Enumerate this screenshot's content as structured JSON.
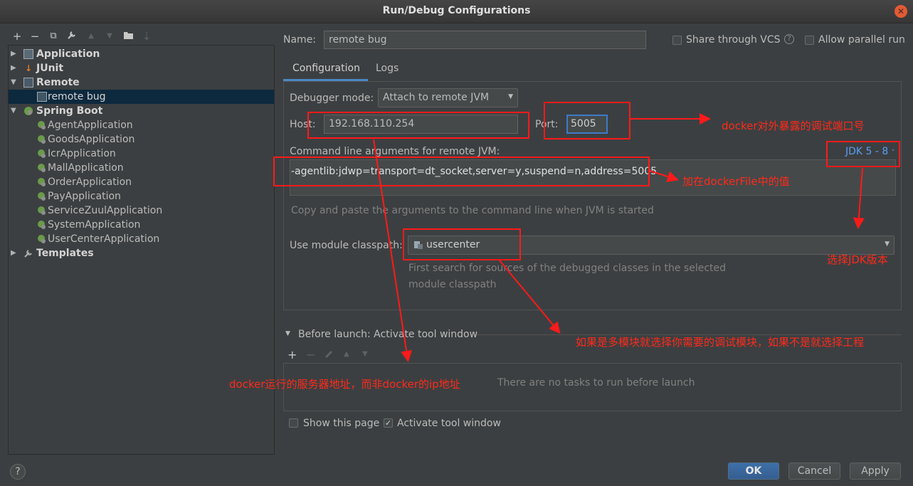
{
  "window": {
    "title": "Run/Debug Configurations"
  },
  "toolbar": {
    "add": "+",
    "remove": "−",
    "copy": "⧉",
    "edit": "🔧",
    "up": "▲",
    "down": "▼",
    "folder": "▪",
    "sort": "⇣"
  },
  "tree": {
    "groups": [
      {
        "label": "Application",
        "icon": "application-icon"
      },
      {
        "label": "JUnit",
        "icon": "junit-icon"
      },
      {
        "label": "Remote",
        "icon": "remote-icon"
      },
      {
        "label": "Spring Boot",
        "icon": "spring-boot-icon"
      },
      {
        "label": "Templates",
        "icon": "wrench-icon"
      }
    ],
    "remote_children": [
      "remote bug"
    ],
    "spring_children": [
      "AgentApplication",
      "GoodsApplication",
      "IcrApplication",
      "MallApplication",
      "OrderApplication",
      "PayApplication",
      "ServiceZuulApplication",
      "SystemApplication",
      "UserCenterApplication"
    ]
  },
  "form": {
    "name_label": "Name:",
    "name_value": "remote bug",
    "share_vcs": "Share through VCS",
    "allow_parallel": "Allow parallel run",
    "tabs": [
      "Configuration",
      "Logs"
    ],
    "debugger_mode_label": "Debugger mode:",
    "debugger_mode_value": "Attach to remote JVM",
    "host_label": "Host:",
    "host_value": "192.168.110.254",
    "port_label": "Port:",
    "port_value": "5005",
    "cmd_label": "Command line arguments for remote JVM:",
    "jdk_label": "JDK 5 - 8",
    "cmd_value": "-agentlib:jdwp=transport=dt_socket,server=y,suspend=n,address=5005",
    "cmd_hint": "Copy and paste the arguments to the command line when JVM is started",
    "module_label": "Use module classpath:",
    "module_value": "usercenter",
    "module_hint_1": "First search for sources of the debugged classes in the selected",
    "module_hint_2": "module classpath",
    "before_launch": "Before launch: Activate tool window",
    "no_tasks": "There are no tasks to run before launch",
    "show_page": "Show this page",
    "activate_tool": "Activate tool window"
  },
  "buttons": {
    "ok": "OK",
    "cancel": "Cancel",
    "apply": "Apply",
    "help": "?"
  },
  "annotations": {
    "port_note": "docker对外暴露的调试端口号",
    "cmd_note": "加在dockerFile中的值",
    "jdk_note": "选择JDK版本",
    "module_note": "如果是多模块就选择你需要的调试模块，如果不是就选择工程",
    "host_note": "docker运行的服务器地址，而非docker的ip地址"
  },
  "colors": {
    "accent": "#589df6",
    "annotation": "#ff1a1a",
    "background": "#3c3f41"
  }
}
